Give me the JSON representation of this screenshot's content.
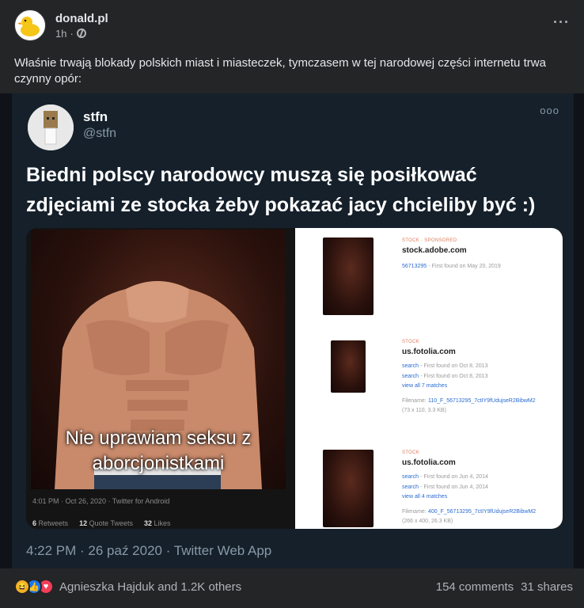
{
  "post": {
    "page_name": "donald.pl",
    "time": "1h",
    "separator": "·",
    "text": "Właśnie trwają blokady polskich miast i miasteczek, tymczasem w tej narodowej części internetu trwa czynny opór:"
  },
  "tweet": {
    "name": "stfn",
    "handle": "@stfn",
    "more": "ooo",
    "text": "Biedni polscy narodowcy muszą się posiłkować zdjęciami ze stocka żeby pokazać jacy chcieliby być :)",
    "footer": "4:22 PM · 26 paź 2020 · Twitter Web App"
  },
  "inner_tweet": {
    "caption": "Nie uprawiam seksu z aborcjonistkami",
    "meta": "4:01 PM · Oct 26, 2020 · Twitter for Android",
    "retweets_count": "6",
    "retweets_label": "Retweets",
    "quotes_count": "12",
    "quotes_label": "Quote Tweets",
    "likes_count": "32",
    "likes_label": "Likes"
  },
  "search_results": [
    {
      "tag": "STOCK · SPONSORED",
      "site": "stock.adobe.com",
      "id": "56713295",
      "first_found": "- First found on May 20, 2019"
    },
    {
      "tag": "STOCK",
      "site": "us.fotolia.com",
      "line1_link": "search",
      "line1": "- First found on Oct 8, 2013",
      "line2_link": "search",
      "line2": "- First found on Oct 8, 2013",
      "view_all": "view all 7 matches",
      "filename_label": "Filename:",
      "filename": "110_F_56713295_7ctIY9fUdujseR2BibwM2",
      "dims": "(73 x 110, 3.3 KB)"
    },
    {
      "tag": "STOCK",
      "site": "us.fotolia.com",
      "line1_link": "search",
      "line1": "- First found on Jun 4, 2014",
      "line2_link": "search",
      "line2": "- First found on Jun 4, 2014",
      "view_all": "view all 4 matches",
      "filename_label": "Filename:",
      "filename": "400_F_56713295_7ctIY9fUdujseR2BibwM2",
      "dims": "(266 x 400, 26.3 KB)"
    }
  ],
  "footer": {
    "reactors": "Agnieszka Hajduk and 1.2K others",
    "comments": "154 comments",
    "shares": "31 shares"
  }
}
